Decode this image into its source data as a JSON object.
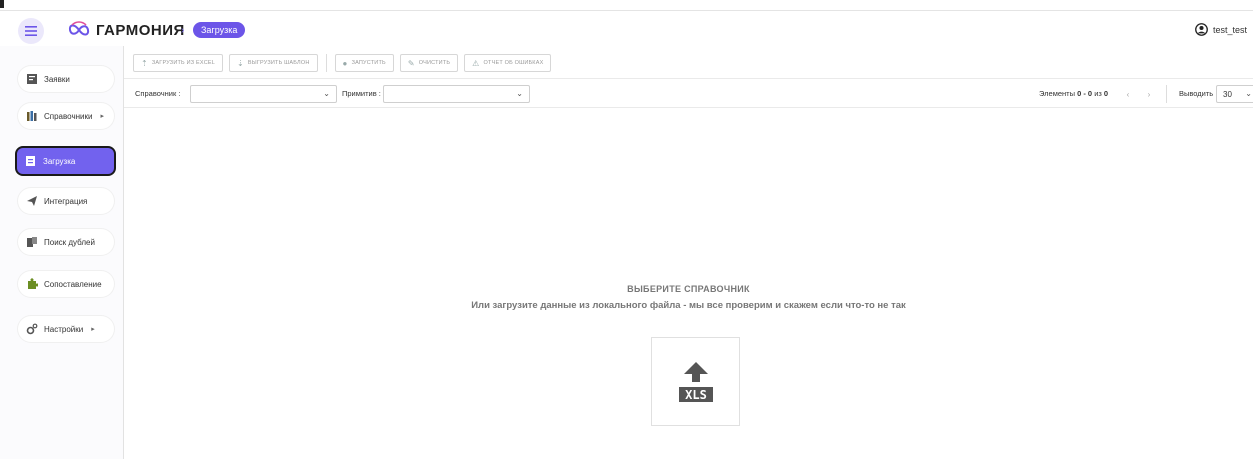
{
  "header": {
    "app_name": "ГАРМОНИЯ",
    "breadcrumb": "Загрузка",
    "breadcrumb_sep": "›",
    "user": "test_test",
    "brand_color": "#6c55e8"
  },
  "sidebar": {
    "items": [
      {
        "label": "Заявки",
        "icon": "document-icon"
      },
      {
        "label": "Справочники",
        "icon": "books-icon",
        "arrow": "▸"
      },
      {
        "label": "Загрузка",
        "icon": "upload-doc-icon",
        "active": true
      },
      {
        "label": "Интеграция",
        "icon": "paper-plane-icon"
      },
      {
        "label": "Поиск дублей",
        "icon": "duplicates-icon"
      },
      {
        "label": "Сопоставление",
        "icon": "puzzle-icon"
      },
      {
        "label": "Настройки",
        "icon": "gears-icon",
        "arrow": "▸"
      }
    ]
  },
  "toolbar": {
    "load_excel": "ЗАГРУЗИТЬ ИЗ EXCEL",
    "export_template": "ВЫГРУЗИТЬ ШАБЛОН",
    "run": "ЗАПУСТИТЬ",
    "clear": "ОЧИСТИТЬ",
    "error_report": "ОТЧЕТ ОБ ОШИБКАХ"
  },
  "filters": {
    "reference_label": "Справочник :",
    "reference_value": "",
    "primitive_label": "Примитив :",
    "primitive_value": "",
    "elements_label": "Элементы",
    "elements_range": "0 - 0",
    "elements_of": "из",
    "elements_total": "0",
    "prev": "‹",
    "next": "›",
    "perpage_label": "Выводить",
    "perpage_value": "30"
  },
  "empty_state": {
    "title": "ВЫБЕРИТЕ СПРАВОЧНИК",
    "subtitle": "Или загрузите данные из локального файла - мы все проверим и скажем если что-то не так",
    "upload_icon": "xls-upload-icon",
    "xls_text": "XLS"
  }
}
